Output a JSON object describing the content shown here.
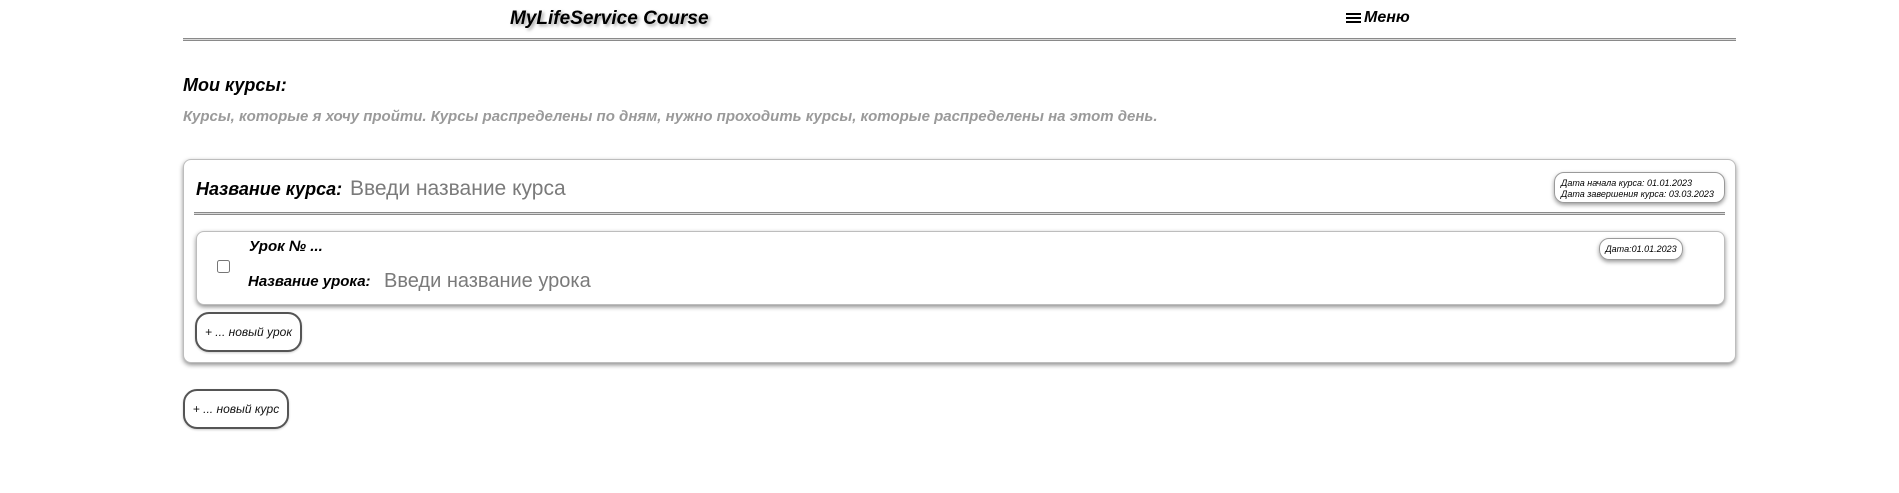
{
  "header": {
    "app_title": "MyLifeService Course",
    "menu_label": "Меню",
    "menu_icon": "hamburger-menu-icon"
  },
  "section": {
    "title": "Мои курсы:",
    "description": "Курсы, которые я хочу пройти. Курсы распределены по дням, нужно проходить курсы, которые распределены на этот день."
  },
  "courses": [
    {
      "name_label": "Название курса:",
      "name_placeholder": "Введи название курса",
      "name_value": "",
      "start_date_text": "Дата начала курса: 01.01.2023",
      "end_date_text": "Дата завершения курса: 03.03.2023",
      "lessons": [
        {
          "checked": false,
          "number_text": "Урок № ...",
          "name_label": "Название урока:",
          "name_placeholder": "Введи название урока",
          "name_value": "",
          "date_text": "Дата:01.01.2023"
        }
      ],
      "new_lesson_label": "+ ... новый урок"
    }
  ],
  "new_course_label": "+ ... новый курс"
}
